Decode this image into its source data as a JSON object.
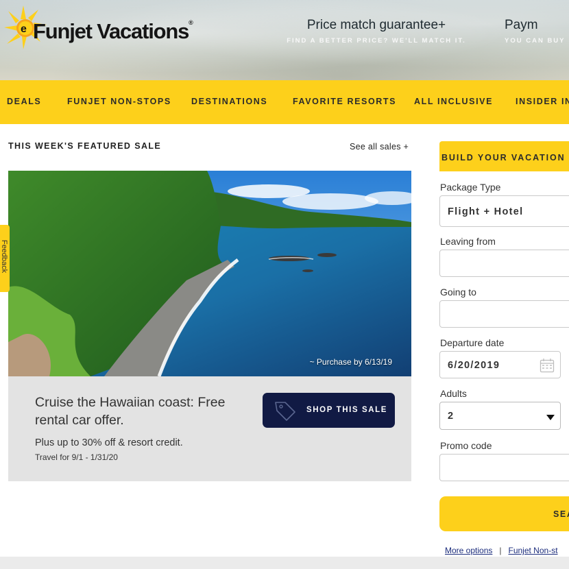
{
  "header": {
    "logo_text": "Funjet Vacations",
    "logo_reg": "®",
    "promo_1_title": "Price match guarantee+",
    "promo_1_sub": "FIND A BETTER PRICE? WE'LL MATCH IT.",
    "promo_2_title": "Paym",
    "promo_2_sub": "YOU CAN BUY"
  },
  "nav": {
    "items": [
      {
        "label": "DEALS"
      },
      {
        "label": "FUNJET NON-STOPS"
      },
      {
        "label": "DESTINATIONS"
      },
      {
        "label": "FAVORITE RESORTS"
      },
      {
        "label": "ALL INCLUSIVE"
      },
      {
        "label": "INSIDER IN"
      }
    ]
  },
  "feedback": {
    "label": "Feedback"
  },
  "featured": {
    "title": "THIS WEEK'S FEATURED SALE",
    "see_all": "See all sales +",
    "purchase_by": "~ Purchase by 6/13/19",
    "headline": "Cruise the Hawaiian coast: Free rental car offer.",
    "subline": "Plus up to 30% off & resort credit.",
    "travel": "Travel for 9/1 - 1/31/20",
    "cta": "SHOP THIS SALE"
  },
  "build": {
    "title": "BUILD YOUR VACATION",
    "package_label": "Package Type",
    "package_value": "Flight + Hotel",
    "leaving_label": "Leaving from",
    "leaving_value": "",
    "going_label": "Going to",
    "going_value": "",
    "departure_label": "Departure date",
    "departure_value": "6/20/2019",
    "adults_label": "Adults",
    "adults_value": "2",
    "promo_label": "Promo code",
    "promo_value": "",
    "search_label": "SEA",
    "more_options": "More options",
    "separator": "|",
    "nonstop_link": "Funjet Non-st"
  },
  "colors": {
    "brand_yellow": "#fdd01b",
    "navy": "#111a44",
    "link_blue": "#1b2c7c"
  }
}
